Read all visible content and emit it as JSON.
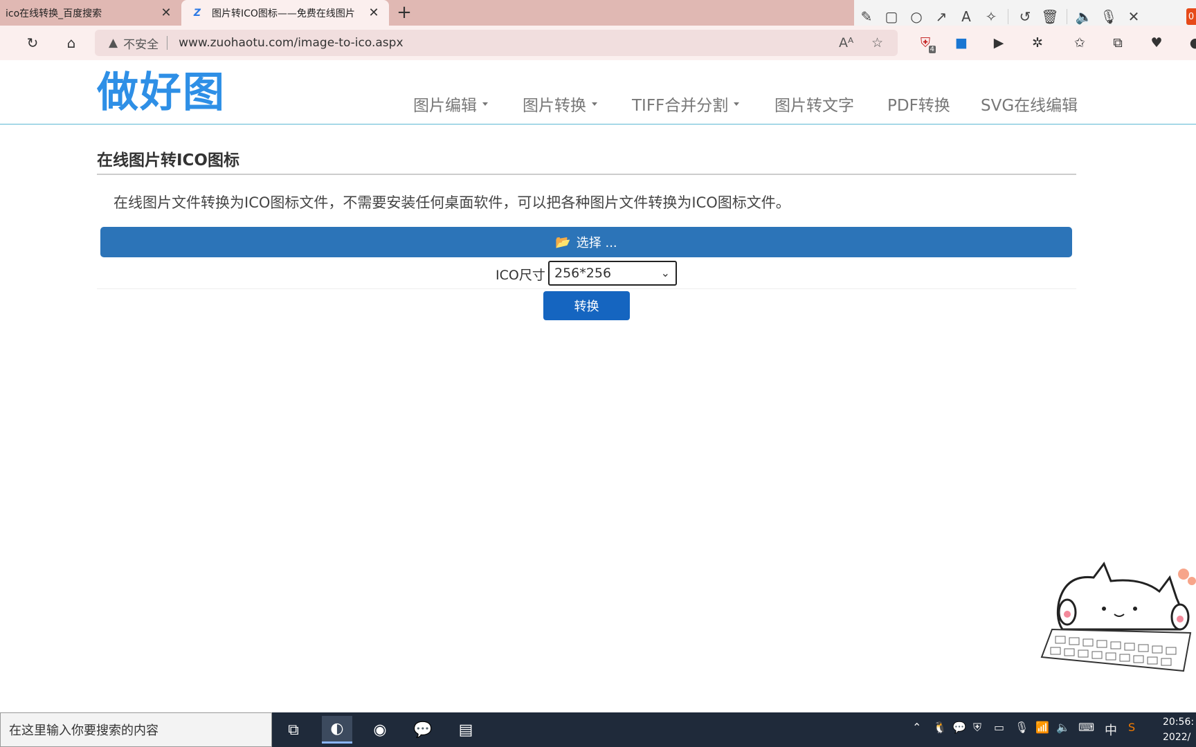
{
  "browser": {
    "tabs": [
      {
        "title": "ico在线转换_百度搜索"
      },
      {
        "title": "图片转ICO图标——免费在线图片"
      }
    ],
    "new_tab": "+",
    "close_glyph": "✕",
    "address": {
      "security_text": "不安全",
      "url": "www.zuohaotu.com/image-to-ico.aspx"
    },
    "extension_badge": "4"
  },
  "annotation_toolbar": {
    "badge": "0"
  },
  "site": {
    "logo": "做好图",
    "nav": [
      {
        "label": "图片编辑",
        "dropdown": true
      },
      {
        "label": "图片转换",
        "dropdown": true
      },
      {
        "label": "TIFF合并分割",
        "dropdown": true
      },
      {
        "label": "图片转文字",
        "dropdown": false
      },
      {
        "label": "PDF转换",
        "dropdown": false
      },
      {
        "label": "SVG在线编辑",
        "dropdown": false
      }
    ]
  },
  "content": {
    "title": "在线图片转ICO图标",
    "description": "在线图片文件转换为ICO图标文件，不需要安装任何桌面软件，可以把各种图片文件转换为ICO图标文件。",
    "choose_label": "选择 ...",
    "size_label": "ICO尺寸",
    "size_value": "256*256",
    "convert_label": "转换"
  },
  "taskbar": {
    "search_placeholder": "在这里输入你要搜索的内容",
    "ime": "中",
    "time": "20:56:",
    "date": "2022/"
  },
  "colors": {
    "brand_blue": "#2e8fe6",
    "choose_button": "#2c74b8",
    "convert_button": "#1565c0",
    "tab_strip": "#e0b8b3"
  }
}
